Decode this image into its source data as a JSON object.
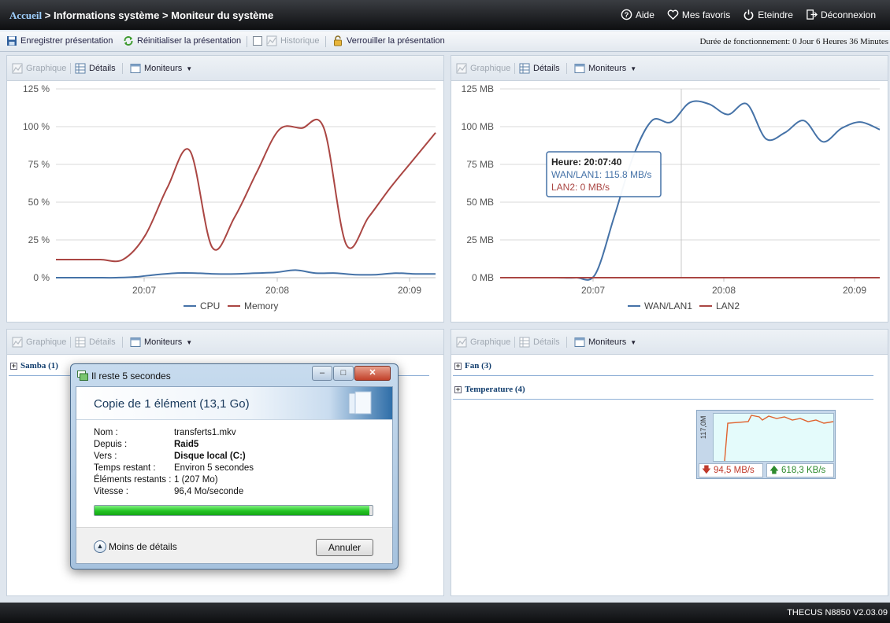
{
  "header": {
    "breadcrumb_home": "Accueil",
    "breadcrumb_rest": " > Informations système > Moniteur du système",
    "nav": {
      "help": "Aide",
      "favorites": "Mes favoris",
      "shutdown": "Eteindre",
      "logout": "Déconnexion"
    }
  },
  "toolbar": {
    "save_layout": "Enregistrer présentation",
    "reset_layout": "Réinitialiser la présentation",
    "history": "Historique",
    "lock_layout": "Verrouiller la présentation",
    "uptime": "Durée de fonctionnement:  0 Jour 6 Heures 36 Minutes"
  },
  "panel_header": {
    "graph": "Graphique",
    "details": "Détails",
    "monitors": "Moniteurs"
  },
  "panels": {
    "samba_label": "Samba (1)",
    "fan_label": "Fan (3)",
    "temperature_label": "Temperature (4)"
  },
  "tooltip": {
    "time": "Heure: 20:07:40",
    "wan": "WAN/LAN1: 115.8 MB/s",
    "lan2": "LAN2: 0 MB/s"
  },
  "chart_data": [
    {
      "type": "line",
      "title": "",
      "ylim": [
        0,
        125
      ],
      "y_ticks": [
        "0 %",
        "25 %",
        "50 %",
        "75 %",
        "100 %",
        "125 %"
      ],
      "x_ticks": [
        "20:07",
        "20:08",
        "20:09"
      ],
      "grid": true,
      "legend": "bottom",
      "series": [
        {
          "name": "CPU",
          "color": "#4572a7",
          "values": [
            0,
            0,
            0,
            0,
            0.5,
            2,
            3,
            3,
            2.5,
            2.5,
            3,
            3.5,
            5,
            3,
            3,
            2,
            2,
            3,
            2.5,
            2.5
          ]
        },
        {
          "name": "Memory",
          "color": "#aa4643",
          "values": [
            12,
            12,
            12,
            12,
            28,
            60,
            84,
            20,
            40,
            70,
            98,
            99,
            99,
            22,
            40,
            60,
            78,
            96
          ]
        }
      ]
    },
    {
      "type": "line",
      "title": "",
      "ylim": [
        0,
        125
      ],
      "y_ticks": [
        "0 MB",
        "25 MB",
        "50 MB",
        "75 MB",
        "100 MB",
        "125 MB"
      ],
      "x_ticks": [
        "20:07",
        "20:08",
        "20:09"
      ],
      "grid": true,
      "legend": "bottom",
      "series": [
        {
          "name": "WAN/LAN1",
          "color": "#4572a7",
          "values": [
            0,
            0,
            0,
            0,
            0,
            2,
            40,
            80,
            104,
            103,
            116,
            115,
            108,
            115,
            92,
            96,
            104,
            90,
            99,
            103,
            98
          ]
        },
        {
          "name": "LAN2",
          "color": "#aa4643",
          "values": [
            0,
            0,
            0,
            0,
            0,
            0,
            0,
            0,
            0,
            0,
            0,
            0,
            0,
            0,
            0,
            0,
            0,
            0,
            0,
            0,
            0
          ]
        }
      ]
    }
  ],
  "copy_dialog": {
    "window_title": "Il reste 5 secondes",
    "heading": "Copie de 1 élément (13,1 Go)",
    "rows": [
      {
        "label": "Nom :",
        "value": "transferts1.mkv",
        "bold": false
      },
      {
        "label": "Depuis :",
        "value": "Raid5",
        "bold": true
      },
      {
        "label": "Vers :",
        "value": "Disque local (C:)",
        "bold": true
      },
      {
        "label": "Temps restant :",
        "value": "Environ 5 secondes",
        "bold": false
      },
      {
        "label": "Éléments restants :",
        "value": "1 (207 Mo)",
        "bold": false
      },
      {
        "label": "Vitesse :",
        "value": "96,4 Mo/seconde",
        "bold": false
      }
    ],
    "progress_fraction": 0.99,
    "less_details": "Moins de détails",
    "cancel": "Annuler"
  },
  "mini_widget": {
    "axis_label": "117,0M",
    "download": "94,5 MB/s",
    "upload": "618,3 KB/s"
  },
  "footer": {
    "version": "THECUS N8850 V2.03.09"
  }
}
